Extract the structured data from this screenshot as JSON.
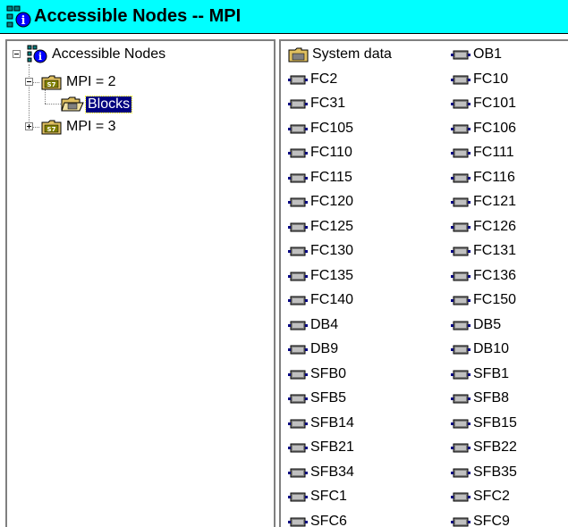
{
  "window": {
    "title": "Accessible Nodes -- MPI"
  },
  "tree": {
    "root_label": "Accessible Nodes",
    "nodes": [
      {
        "label": "MPI = 2",
        "expander": "minus"
      },
      {
        "label": "Blocks",
        "selected": true
      },
      {
        "label": "MPI = 3",
        "expander": "plus"
      }
    ]
  },
  "blocks": {
    "column1": [
      "System data",
      "FC2",
      "FC31",
      "FC105",
      "FC110",
      "FC115",
      "FC120",
      "FC125",
      "FC130",
      "FC135",
      "FC140",
      "DB4",
      "DB9",
      "SFB0",
      "SFB5",
      "SFB14",
      "SFB21",
      "SFB34",
      "SFC1",
      "SFC6"
    ],
    "column2": [
      "OB1",
      "FC10",
      "FC101",
      "FC106",
      "FC111",
      "FC116",
      "FC121",
      "FC126",
      "FC131",
      "FC136",
      "FC150",
      "DB5",
      "DB10",
      "SFB1",
      "SFB8",
      "SFB15",
      "SFB22",
      "SFB35",
      "SFC2",
      "SFC9"
    ]
  },
  "icons": {
    "title": "network-nodes-icon",
    "root": "network-nodes-icon",
    "station": "s7-folder-icon",
    "blocks_folder": "open-folder-icon",
    "system_data": "system-data-folder-icon",
    "block": "block-module-icon"
  },
  "colors": {
    "titlebar": "#00ffff",
    "selection": "#000080"
  }
}
